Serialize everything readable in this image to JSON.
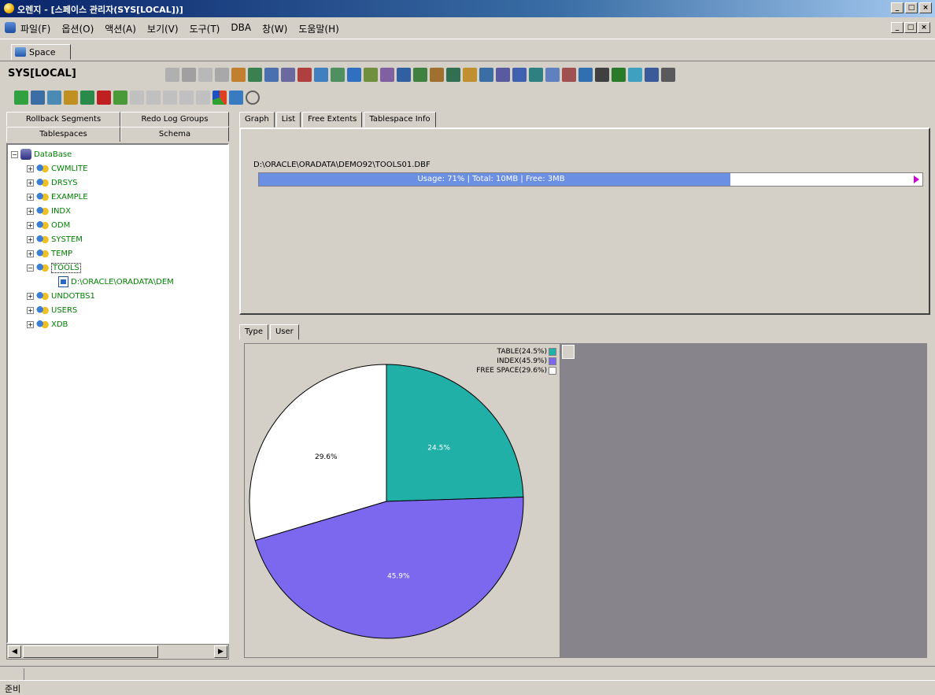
{
  "window": {
    "title": "오렌지 - [스페이스 관리자(SYS[LOCAL])]"
  },
  "menu": [
    "파일(F)",
    "옵션(O)",
    "액션(A)",
    "보기(V)",
    "도구(T)",
    "DBA",
    "창(W)",
    "도움말(H)"
  ],
  "doc_tab": {
    "label": "Space"
  },
  "connection": {
    "label": "SYS[LOCAL]"
  },
  "left_tabs": {
    "row1": [
      "Rollback Segments",
      "Redo Log Groups"
    ],
    "row2": [
      "Tablespaces",
      "Schema"
    ]
  },
  "tree": {
    "root": "DataBase",
    "items": [
      "CWMLITE",
      "DRSYS",
      "EXAMPLE",
      "INDX",
      "ODM",
      "SYSTEM",
      "TEMP",
      "TOOLS"
    ],
    "tools_child": "D:\\ORACLE\\ORADATA\\DEM",
    "items_after": [
      "UNDOTBS1",
      "USERS",
      "XDB"
    ]
  },
  "top_tabs": [
    "Graph",
    "List",
    "Free Extents",
    "Tablespace Info"
  ],
  "datafile": {
    "path": "D:\\ORACLE\\ORADATA\\DEMO92\\TOOLS01.DBF",
    "usage_text": "Usage: 71% | Total: 10MB | Free: 3MB",
    "usage_fraction": 0.71
  },
  "bottom_tabs": [
    "Type",
    "User"
  ],
  "status": {
    "text": "준비"
  },
  "chart_data": {
    "type": "pie",
    "legend_position": "top-right",
    "series": [
      {
        "name": "TABLE(24.5%)",
        "value": 24.5,
        "label": "24.5%",
        "color": "#20b0a8"
      },
      {
        "name": "INDEX(45.9%)",
        "value": 45.9,
        "label": "45.9%",
        "color": "#7b68ee"
      },
      {
        "name": "FREE SPACE(29.6%)",
        "value": 29.6,
        "label": "29.6%",
        "color": "#ffffff"
      }
    ]
  },
  "colors": {
    "title_start": "#0a246a",
    "usage_fill": "#6b8fe3",
    "tree_text": "#008000"
  }
}
